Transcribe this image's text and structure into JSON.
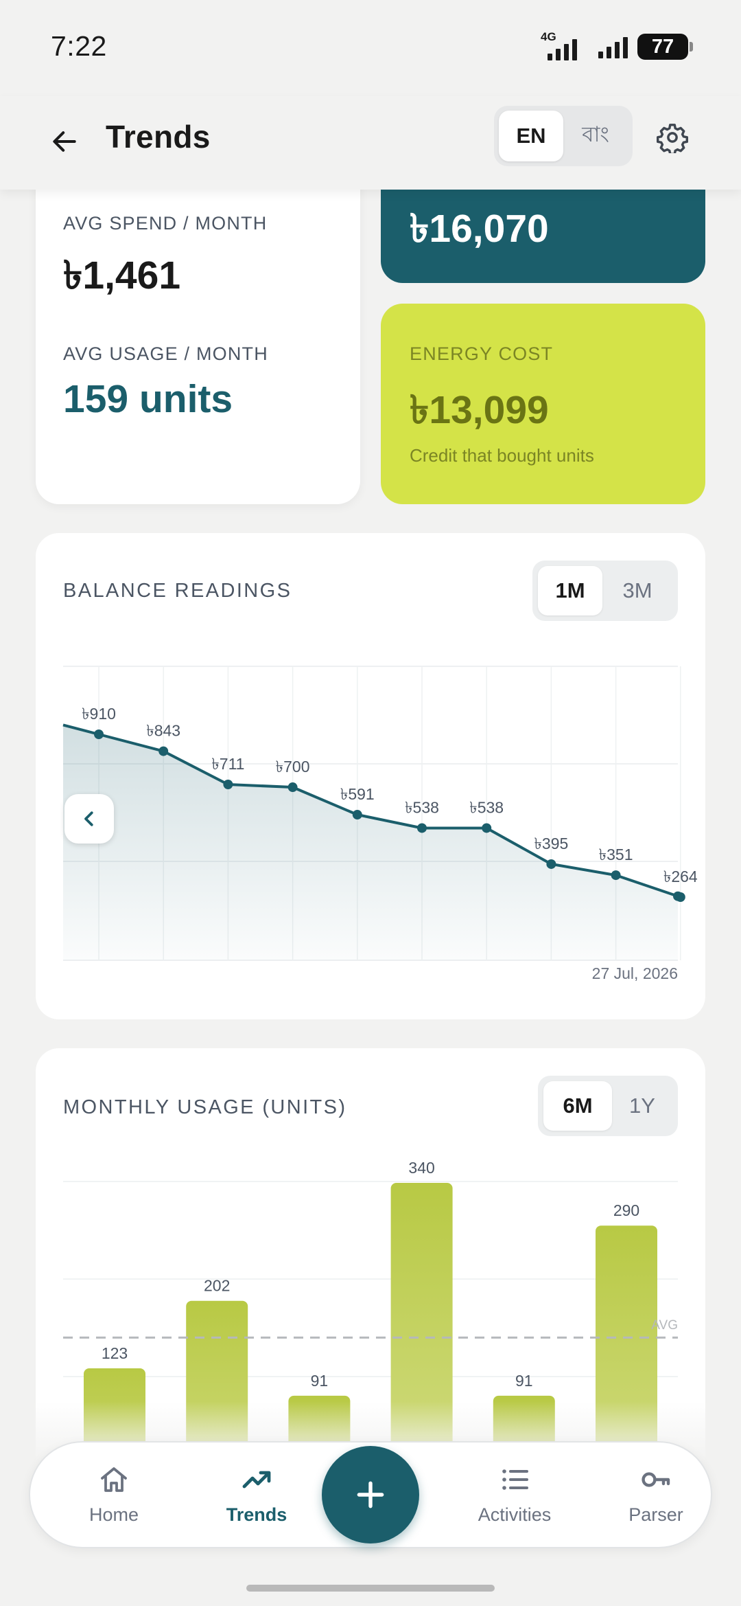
{
  "status_bar": {
    "time": "7:22",
    "network": "4G",
    "battery": "77"
  },
  "header": {
    "title": "Trends",
    "lang_options": [
      "EN",
      "বাং"
    ],
    "lang_selected": "EN"
  },
  "summary": {
    "avg_spend_label": "AVG SPEND / MONTH",
    "avg_spend_value": "৳1,461",
    "avg_usage_label": "AVG USAGE / MONTH",
    "avg_usage_value": "159 units",
    "total_value": "৳16,070",
    "energy_label": "ENERGY COST",
    "energy_value": "৳13,099",
    "energy_sub": "Credit that bought units"
  },
  "balance_section": {
    "title": "BALANCE READINGS",
    "ranges": [
      "1M",
      "3M"
    ],
    "range_selected": "1M",
    "end_date": "27 Jul, 2026"
  },
  "usage_section": {
    "title": "MONTHLY USAGE (UNITS)",
    "ranges": [
      "6M",
      "1Y"
    ],
    "range_selected": "6M",
    "avg_label": "AVG"
  },
  "nav": {
    "home": "Home",
    "trends": "Trends",
    "activities": "Activities",
    "parser": "Parser",
    "active": "Trends"
  },
  "colors": {
    "primary": "#1b5e6b",
    "lime": "#d4e348",
    "bar": "#bccb4a"
  },
  "icons": [
    "back-arrow-icon",
    "gear-icon",
    "chevron-left-icon",
    "home-icon",
    "trend-icon",
    "plus-icon",
    "list-icon",
    "key-icon"
  ],
  "chart_data": [
    {
      "type": "line",
      "title": "BALANCE READINGS",
      "currency": "৳",
      "values": [
        910,
        843,
        711,
        700,
        591,
        538,
        538,
        395,
        351,
        264
      ],
      "labels": [
        "৳910",
        "৳843",
        "৳711",
        "৳700",
        "৳591",
        "৳538",
        "৳538",
        "৳395",
        "৳351",
        "৳264"
      ],
      "x_end_label": "27 Jul, 2026",
      "grid": true
    },
    {
      "type": "bar",
      "title": "MONTHLY USAGE (UNITS)",
      "values": [
        123,
        202,
        91,
        340,
        91,
        290
      ],
      "average_line": 159,
      "average_label": "AVG",
      "grid": true
    }
  ]
}
